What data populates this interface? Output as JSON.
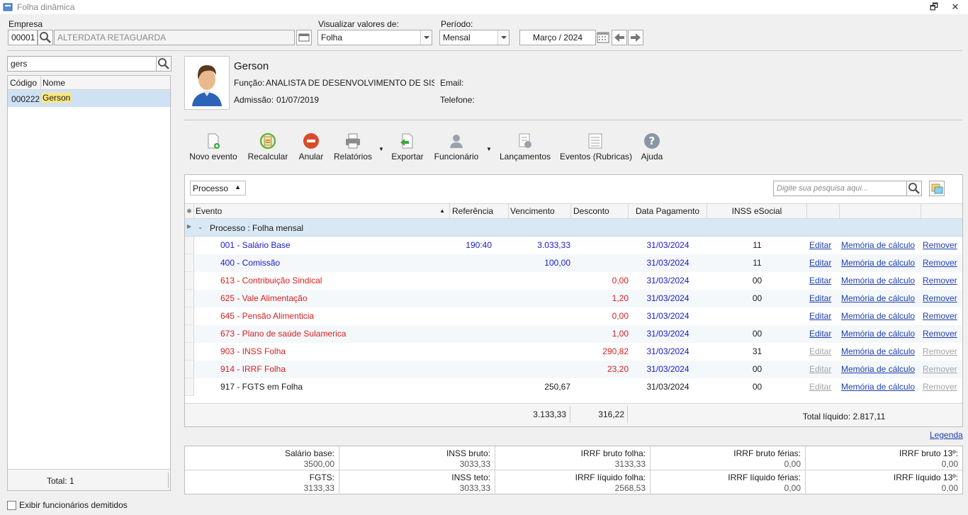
{
  "window": {
    "title": "Folha dinâmica"
  },
  "empresa": {
    "label": "Empresa",
    "code": "00001",
    "name": "ALTERDATA RETAGUARDA"
  },
  "visualizar": {
    "label": "Visualizar valores de:",
    "value": "Folha"
  },
  "periodo": {
    "label": "Período:",
    "value": "Mensal",
    "date": "Março / 2024"
  },
  "search": {
    "value": "gers"
  },
  "employees": {
    "col_codigo": "Código",
    "col_nome": "Nome",
    "rows": [
      {
        "code": "000222",
        "name": "Gerson"
      }
    ],
    "total": "Total: 1"
  },
  "profile": {
    "name": "Gerson",
    "funcao_label": "Função:",
    "funcao": "ANALISTA DE DESENVOLVIMENTO DE SISTEM",
    "admissao_label": "Admissão:",
    "admissao": "01/07/2019",
    "email_label": "Email:",
    "telefone_label": "Telefone:"
  },
  "toolbar": {
    "novo_evento": "Novo evento",
    "recalcular": "Recalcular",
    "anular": "Anular",
    "relatorios": "Relatórios",
    "exportar": "Exportar",
    "funcionario": "Funcionário",
    "lancamentos": "Lançamentos",
    "eventos": "Eventos (Rubricas)",
    "ajuda": "Ajuda"
  },
  "grid": {
    "group_button": "Processo",
    "search_placeholder": "Digite sua pesquisa aqui...",
    "columns": {
      "evento": "Evento",
      "referencia": "Referência",
      "vencimento": "Vencimento",
      "desconto": "Desconto",
      "data_pagamento": "Data Pagamento",
      "inss_esocial": "INSS eSocial"
    },
    "group_label": "Processo : Folha mensal",
    "rows": [
      {
        "evento": "001 - Salário Base",
        "referencia": "190:40",
        "vencimento": "3.033,33",
        "desconto": "",
        "data": "31/03/2024",
        "inss": "11",
        "edit": "Editar",
        "memoria": "Memória de cálculo",
        "remover": "Remover"
      },
      {
        "evento": "400 - Comissão",
        "referencia": "",
        "vencimento": "100,00",
        "desconto": "",
        "data": "31/03/2024",
        "inss": "11",
        "edit": "Editar",
        "memoria": "Memória de cálculo",
        "remover": "Remover"
      },
      {
        "evento": "613 - Contribuição Sindical",
        "referencia": "",
        "vencimento": "",
        "desconto": "0,00",
        "data": "31/03/2024",
        "inss": "00",
        "edit": "Editar",
        "memoria": "Memória de cálculo",
        "remover": "Remover"
      },
      {
        "evento": "625 - Vale Alimentação",
        "referencia": "",
        "vencimento": "",
        "desconto": "1,20",
        "data": "31/03/2024",
        "inss": "00",
        "edit": "Editar",
        "memoria": "Memória de cálculo",
        "remover": "Remover"
      },
      {
        "evento": "645 - Pensão Alimenticia",
        "referencia": "",
        "vencimento": "",
        "desconto": "0,00",
        "data": "31/03/2024",
        "inss": "",
        "edit": "Editar",
        "memoria": "Memória de cálculo",
        "remover": "Remover"
      },
      {
        "evento": "673 - Plano de saúde Sulamerica",
        "referencia": "",
        "vencimento": "",
        "desconto": "1,00",
        "data": "31/03/2024",
        "inss": "00",
        "edit": "Editar",
        "memoria": "Memória de cálculo",
        "remover": "Remover"
      },
      {
        "evento": "903 - INSS Folha",
        "referencia": "",
        "vencimento": "",
        "desconto": "290,82",
        "data": "31/03/2024",
        "inss": "31",
        "edit": "Editar",
        "memoria": "Memória de cálculo",
        "remover": "Remover"
      },
      {
        "evento": "914 - IRRF Folha",
        "referencia": "",
        "vencimento": "",
        "desconto": "23,20",
        "data": "31/03/2024",
        "inss": "00",
        "edit": "Editar",
        "memoria": "Memória de cálculo",
        "remover": "Remover"
      },
      {
        "evento": "917 - FGTS em Folha",
        "referencia": "",
        "vencimento": "250,67",
        "desconto": "",
        "data": "31/03/2024",
        "inss": "00",
        "edit": "Editar",
        "memoria": "Memória de cálculo",
        "remover": "Remover"
      }
    ],
    "total_vencimento": "3.133,33",
    "total_desconto": "316,22",
    "total_liquido": "Total líquido: 2.817,11"
  },
  "legenda": "Legenda",
  "summary": {
    "salario_base_label": "Salário base:",
    "salario_base": "3500,00",
    "inss_bruto_label": "INSS bruto:",
    "inss_bruto": "3033,33",
    "irrf_bruto_folha_label": "IRRF bruto folha:",
    "irrf_bruto_folha": "3133,33",
    "irrf_bruto_ferias_label": "IRRF bruto férias:",
    "irrf_bruto_ferias": "0,00",
    "irrf_bruto_13_label": "IRRF bruto 13º:",
    "irrf_bruto_13": "0,00",
    "fgts_label": "FGTS:",
    "fgts": "3133,33",
    "inss_teto_label": "INSS teto:",
    "inss_teto": "3033,33",
    "irrf_liquido_folha_label": "IRRF líquido folha:",
    "irrf_liquido_folha": "2568,53",
    "irrf_liquido_ferias_label": "IRRF líquido férias:",
    "irrf_liquido_ferias": "0,00",
    "irrf_liquido_13_label": "IRRF líquido 13º:",
    "irrf_liquido_13": "0,00"
  },
  "exibir_demitidos": "Exibir funcionários demitidos",
  "colors": {
    "blue": "#1a1acc",
    "red": "#d81e1e",
    "link": "#1e3fae",
    "selection": "#cfe2f3"
  }
}
